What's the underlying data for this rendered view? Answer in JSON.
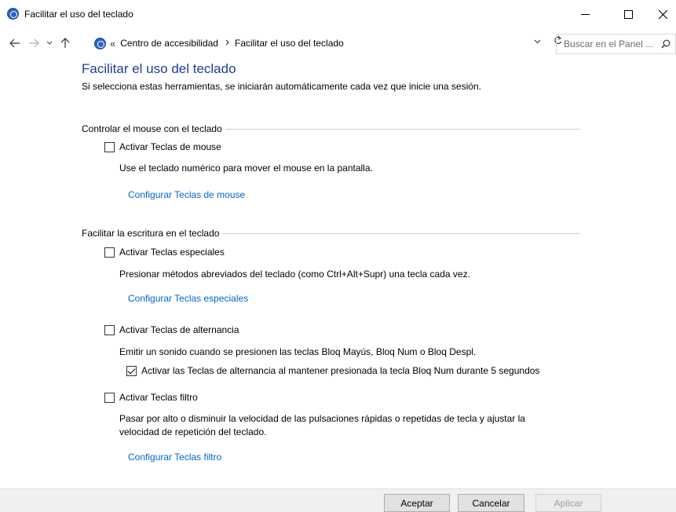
{
  "window": {
    "title": "Facilitar el uso del teclado",
    "icon": "ease-of-access-icon"
  },
  "navigation": {
    "breadcrumb_prefix": "«",
    "breadcrumbs": [
      "Centro de accesibilidad",
      "Facilitar el uso del teclado"
    ],
    "search_placeholder": "Buscar en el Panel ..."
  },
  "page": {
    "title": "Facilitar el uso del teclado",
    "subtitle": "Si selecciona estas herramientas, se iniciarán automáticamente cada vez que inicie una sesión."
  },
  "sections": [
    {
      "heading": "Controlar el mouse con el teclado",
      "mouse_keys": {
        "label": "Activar Teclas de mouse",
        "checked": false,
        "description": "Use el teclado numérico para mover el mouse en la pantalla.",
        "link": "Configurar Teclas de mouse"
      }
    },
    {
      "heading": "Facilitar la escritura en el teclado",
      "sticky_keys": {
        "label": "Activar Teclas especiales",
        "checked": false,
        "description": "Presionar métodos abreviados del teclado (como Ctrl+Alt+Supr) una tecla cada vez.",
        "link": "Configurar Teclas especiales"
      },
      "toggle_keys": {
        "label": "Activar Teclas de alternancia",
        "checked": false,
        "description": "Emitir un sonido cuando se presionen las teclas Bloq Mayús, Bloq Num o Bloq Despl.",
        "sub_option_label": "Activar las Teclas de alternancia al mantener presionada la tecla Bloq Num durante 5 segundos",
        "sub_option_checked": true
      },
      "filter_keys": {
        "label": "Activar Teclas filtro",
        "checked": false,
        "description_line1": "Pasar por alto o disminuir la velocidad de las pulsaciones rápidas o repetidas de tecla y ajustar la",
        "description_line2": "velocidad de repetición del teclado.",
        "link": "Configurar Teclas filtro"
      }
    }
  ],
  "footer": {
    "ok": "Aceptar",
    "cancel": "Cancelar",
    "apply": "Aplicar",
    "apply_enabled": false
  }
}
